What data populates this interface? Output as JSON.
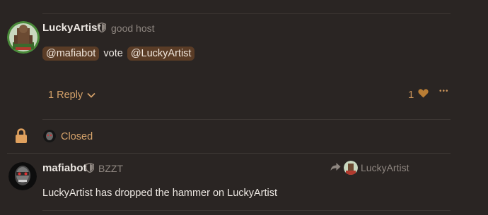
{
  "post1": {
    "username": "LuckyArtist",
    "user_title": "good host",
    "mention1": "@mafiabot",
    "body_word": "vote",
    "mention2": "@LuckyArtist",
    "replies_label": "1 Reply",
    "like_count": "1",
    "more_label": "•••"
  },
  "closed_notice": {
    "label": "Closed"
  },
  "post2": {
    "username": "mafiabot",
    "user_title": "BZZT",
    "reply_to_user": "LuckyArtist",
    "body": "LuckyArtist has dropped the hammer on LuckyArtist"
  },
  "colors": {
    "background": "#2a2523",
    "accent": "#d5a26a",
    "mention_bg": "#5a3c26",
    "lock": "#e0a15e"
  }
}
